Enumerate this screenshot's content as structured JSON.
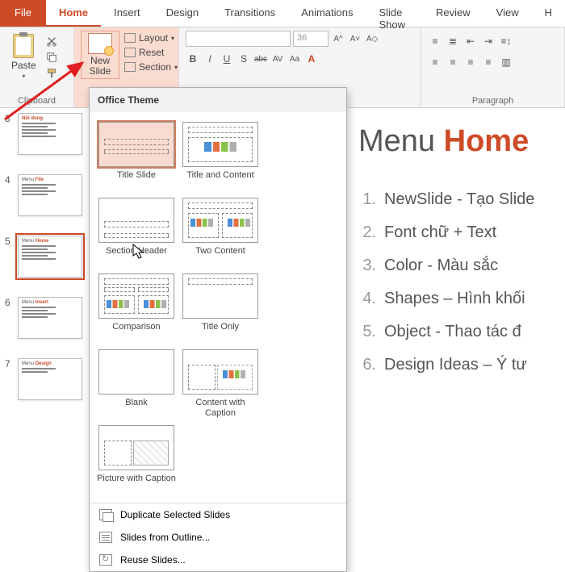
{
  "tabs": {
    "file": "File",
    "items": [
      "Home",
      "Insert",
      "Design",
      "Transitions",
      "Animations",
      "Slide Show",
      "Review",
      "View",
      "H"
    ],
    "active": 0
  },
  "ribbon": {
    "clipboard": {
      "paste": "Paste",
      "label": "Clipboard"
    },
    "slides": {
      "newslide": "New\nSlide",
      "layout": "Layout",
      "reset": "Reset",
      "section": "Section"
    },
    "font": {
      "placeholder": "",
      "size": "36",
      "label": "",
      "btns": {
        "b": "B",
        "i": "I",
        "u": "U",
        "s": "S",
        "abc": "abc",
        "av": "AV",
        "aa": "Aa",
        "a": "A"
      }
    },
    "paragraph": {
      "label": "Paragraph"
    }
  },
  "gallery": {
    "header": "Office Theme",
    "layouts": [
      "Title Slide",
      "Title and Content",
      "Section Header",
      "Two Content",
      "Comparison",
      "Title Only",
      "Blank",
      "Content with Caption",
      "Picture with Caption"
    ],
    "footer": {
      "dup": "Duplicate Selected Slides",
      "outline": "Slides from Outline...",
      "reuse": "Reuse Slides..."
    }
  },
  "thumbs": [
    {
      "n": "3",
      "title_pre": "",
      "title_acc": "Nội dung",
      "sel": false
    },
    {
      "n": "4",
      "title_pre": "Menu ",
      "title_acc": "File",
      "sel": false
    },
    {
      "n": "5",
      "title_pre": "Menu ",
      "title_acc": "Home",
      "sel": true
    },
    {
      "n": "6",
      "title_pre": "Menu ",
      "title_acc": "Insert",
      "sel": false
    },
    {
      "n": "7",
      "title_pre": "Menu ",
      "title_acc": "Design",
      "sel": false
    }
  ],
  "slide": {
    "title_pre": "Menu ",
    "title_acc": "Home",
    "items": [
      "NewSlide - Tạo Slide",
      "Font chữ + Text",
      "Color - Màu sắc",
      "Shapes – Hình khối",
      "Object - Thao tác đ",
      "Design Ideas – Ý tư"
    ]
  }
}
